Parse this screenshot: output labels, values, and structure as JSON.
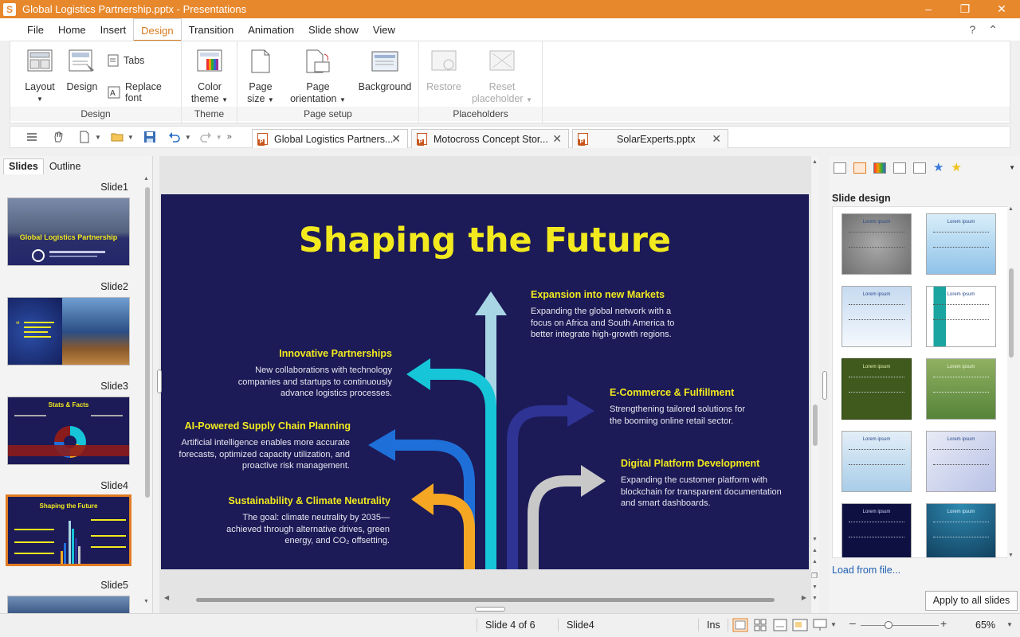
{
  "window": {
    "title": "Global Logistics Partnership.pptx - Presentations",
    "app_letter": "S"
  },
  "menu": [
    "File",
    "Home",
    "Insert",
    "Design",
    "Transition",
    "Animation",
    "Slide show",
    "View"
  ],
  "ribbon": {
    "layout": "Layout",
    "design": "Design",
    "tabs": "Tabs",
    "replace_font": "Replace font",
    "group_design": "Design",
    "color_theme_1": "Color",
    "color_theme_2": "theme",
    "group_theme": "Theme",
    "page_size_1": "Page",
    "page_size_2": "size",
    "page_orient_1": "Page",
    "page_orient_2": "orientation",
    "background": "Background",
    "group_page_setup": "Page setup",
    "restore": "Restore",
    "reset_1": "Reset",
    "reset_2": "placeholder",
    "group_placeholders": "Placeholders"
  },
  "doc_tabs": [
    {
      "label": "Global Logistics Partners..."
    },
    {
      "label": "Motocross Concept Stor..."
    },
    {
      "label": "SolarExperts.pptx"
    }
  ],
  "left_panel": {
    "tab_slides": "Slides",
    "tab_outline": "Outline",
    "slides": [
      "Slide1",
      "Slide2",
      "Slide3",
      "Slide4",
      "Slide5"
    ],
    "thumb1_title": "Global Logistics Partnership",
    "thumb3_title": "Stats & Facts",
    "thumb4_title": "Shaping the Future"
  },
  "slide": {
    "title": "Shaping the Future",
    "items": [
      {
        "head": "Expansion into new Markets",
        "body": [
          "Expanding the global network with a",
          "focus on Africa and South America to",
          "better integrate high-growth regions."
        ]
      },
      {
        "head": "Innovative Partnerships",
        "body": [
          "New collaborations with technology",
          "companies and startups to continuously",
          "advance logistics processes."
        ]
      },
      {
        "head": "E-Commerce & Fulfillment",
        "body": [
          "Strengthening tailored solutions for",
          "the booming online retail sector."
        ]
      },
      {
        "head": "AI-Powered Supply Chain Planning",
        "body": [
          "Artificial intelligence enables more accurate",
          "forecasts, optimized capacity utilization, and",
          "proactive risk management."
        ]
      },
      {
        "head": "Digital Platform Development",
        "body": [
          "Expanding the customer platform with",
          "blockchain for transparent documentation",
          "and smart dashboards."
        ]
      },
      {
        "head": "Sustainability & Climate Neutrality",
        "body": [
          "The goal: climate neutrality by 2035—",
          "achieved through alternative drives, green",
          "energy, and CO₂ offsetting."
        ]
      }
    ],
    "arrow_colors": {
      "light_blue": "#a9d6e5",
      "cyan": "#16c5d8",
      "navy": "#2e3394",
      "blue": "#1f6fd8",
      "orange": "#f5a623",
      "gray": "#c8c8c8"
    }
  },
  "right_panel": {
    "title": "Slide design",
    "template_label": "Lorem ipsum",
    "load_link": "Load from file...",
    "apply_button": "Apply to all slides"
  },
  "status": {
    "slide_pos": "Slide 4 of 6",
    "slide_name": "Slide4",
    "mode": "Ins",
    "zoom": "65%"
  },
  "colors": {
    "accent": "#e8882c",
    "slide_bg": "#1c1a57",
    "slide_title": "#f2ea1e"
  }
}
